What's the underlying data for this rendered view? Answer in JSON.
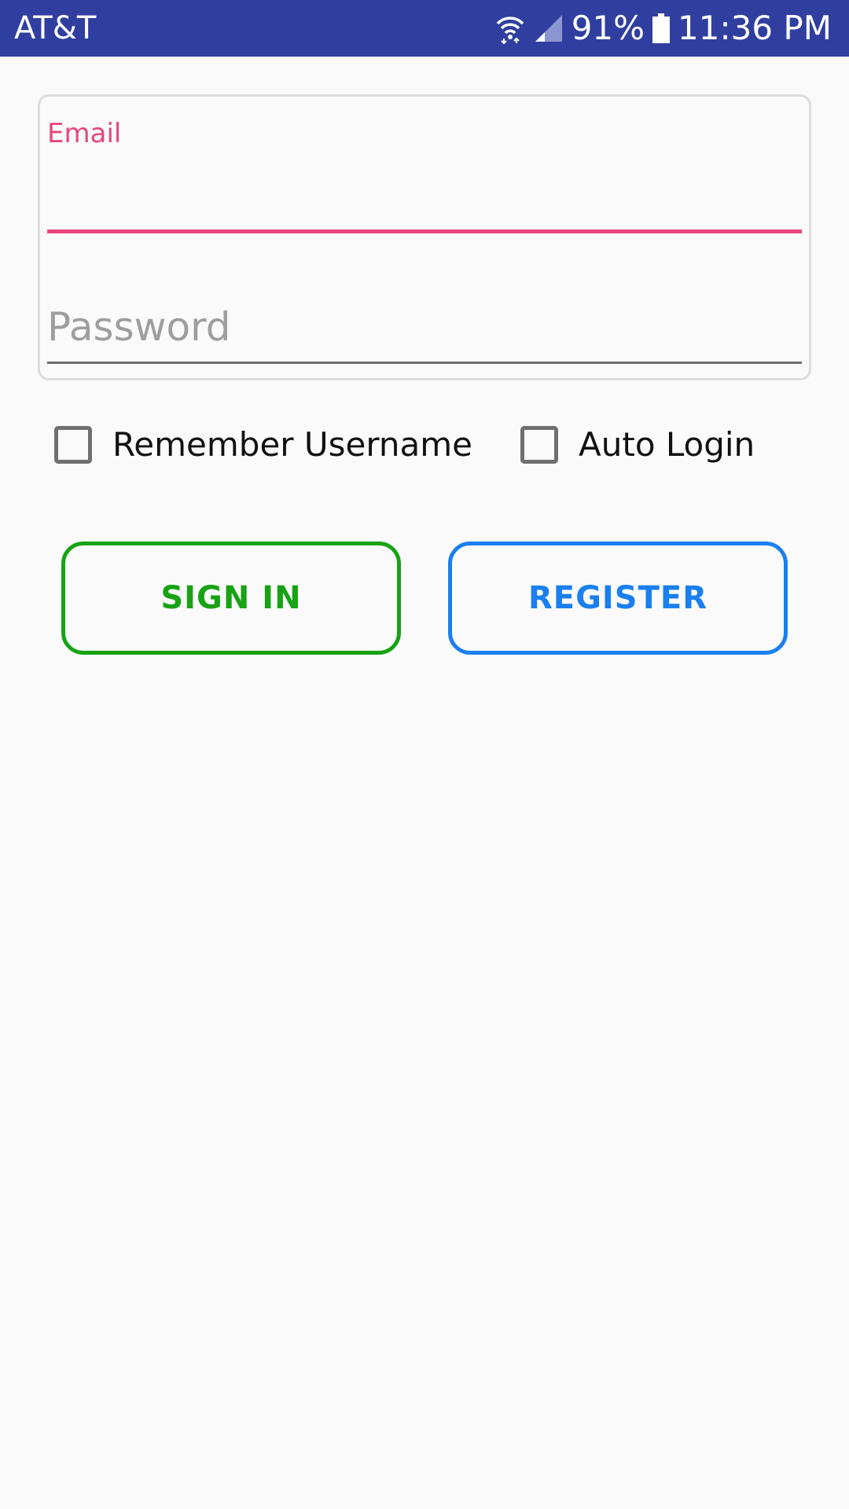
{
  "status_bar": {
    "carrier": "AT&T",
    "battery": "91%",
    "time": "11:36 PM",
    "icons": [
      "wifi-icon",
      "signal-icon",
      "battery-icon"
    ],
    "background_color": "#303f9f"
  },
  "login_form": {
    "email": {
      "label": "Email",
      "value": "",
      "accent_color": "#e8457e"
    },
    "password": {
      "placeholder": "Password",
      "value": ""
    }
  },
  "options": {
    "remember_username": {
      "label": "Remember Username",
      "checked": false
    },
    "auto_login": {
      "label": "Auto Login",
      "checked": false
    }
  },
  "actions": {
    "sign_in": {
      "label": "SIGN IN",
      "color": "#17a314"
    },
    "register": {
      "label": "REGISTER",
      "color": "#1a7ff0"
    }
  }
}
